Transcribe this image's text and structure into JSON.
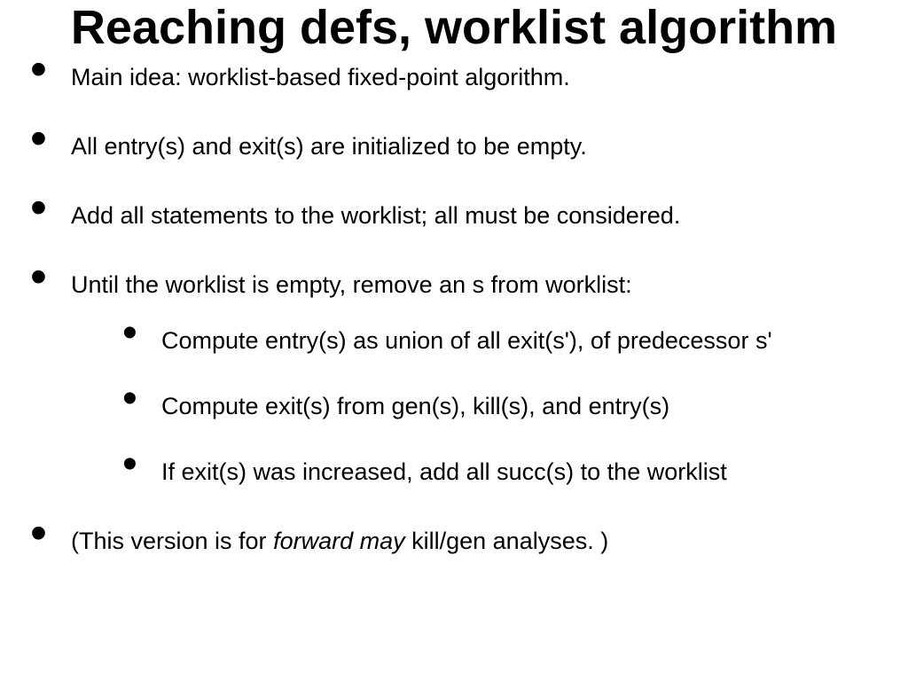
{
  "title": "Reaching defs, worklist algorithm",
  "bullets": [
    "Main idea: worklist-based fixed-point algorithm.",
    "All entry(s) and exit(s) are initialized to be empty.",
    "Add all statements to the worklist; all must be considered.",
    "Until the worklist is empty, remove an s from worklist:"
  ],
  "sub_bullets": [
    "Compute entry(s) as union of all exit(s'), of predecessor s'",
    "Compute exit(s) from gen(s), kill(s), and entry(s)",
    "If exit(s) was increased, add all succ(s) to the worklist"
  ],
  "last_prefix": "(This version is for ",
  "last_em": "forward may",
  "last_suffix": " kill/gen analyses. )"
}
